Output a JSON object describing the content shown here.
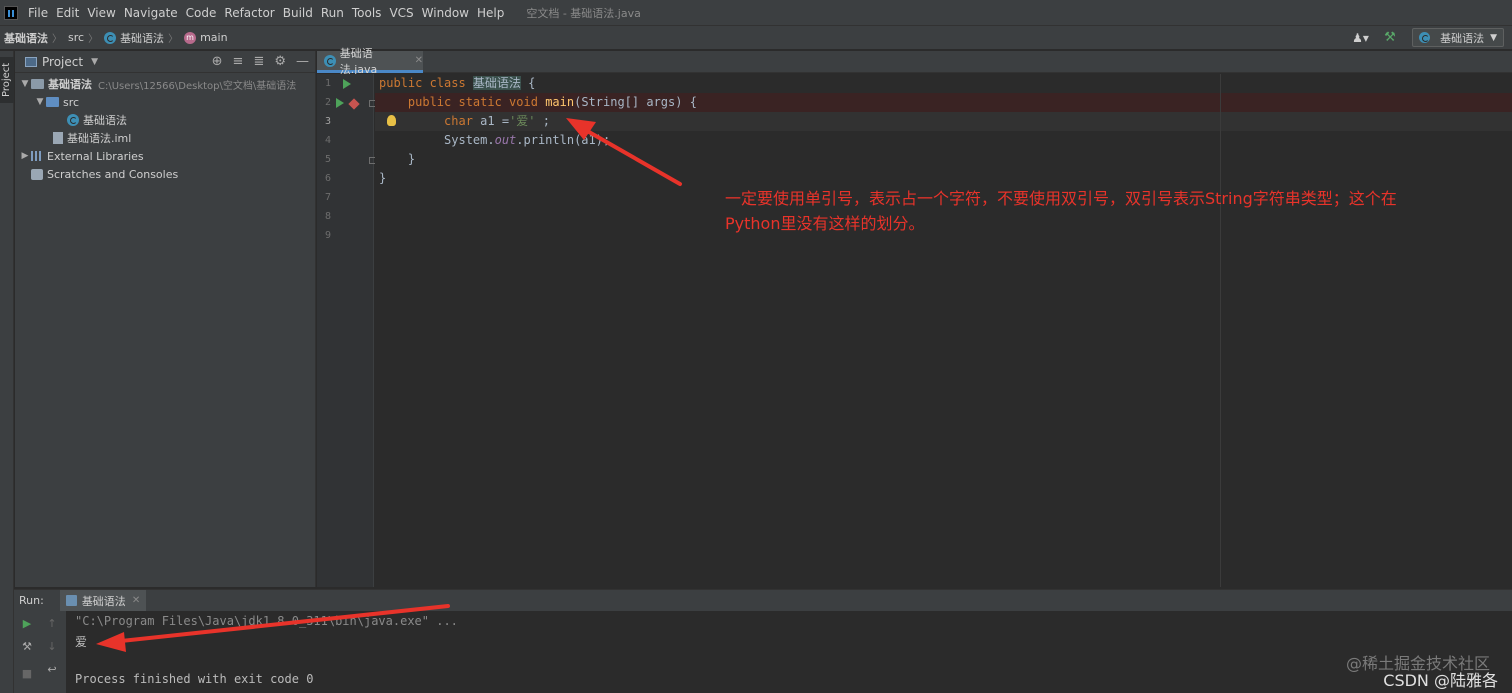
{
  "menubar": {
    "items": [
      "File",
      "Edit",
      "View",
      "Navigate",
      "Code",
      "Refactor",
      "Build",
      "Run",
      "Tools",
      "VCS",
      "Window",
      "Help"
    ],
    "window_title": "空文档 - 基础语法.java"
  },
  "breadcrumb": {
    "project": "基础语法",
    "folder": "src",
    "class": "基础语法",
    "method": "main"
  },
  "nav_right": {
    "run_config": "基础语法"
  },
  "left_strip": {
    "label": "Project"
  },
  "project_panel": {
    "title": "Project",
    "root_name": "基础语法",
    "root_path": "C:\\Users\\12566\\Desktop\\空文档\\基础语法",
    "src": "src",
    "class_file": "基础语法",
    "iml_file": "基础语法.iml",
    "external_libraries": "External Libraries",
    "scratches": "Scratches and Consoles"
  },
  "editor": {
    "tab_label": "基础语法.java",
    "line_numbers": [
      "1",
      "2",
      "3",
      "4",
      "5",
      "6",
      "7",
      "8",
      "9"
    ],
    "code": {
      "l1_kw": "public class ",
      "l1_cls": "基础语法",
      "l1_rest": " {",
      "l2_indent": "    ",
      "l2_kw": "public static void ",
      "l2_fn": "main",
      "l2_rest": "(String[] args) {",
      "l3_indent": "         ",
      "l3_kw": "char",
      "l3_mid": " a1 =",
      "l3_str": "'爱'",
      "l3_rest": " ;",
      "l4_a": "         System.",
      "l4_fld": "out",
      "l4_b": ".println(a1);",
      "l5": "    }",
      "l6": "}"
    }
  },
  "annotation": {
    "line1": "一定要使用单引号，表示占一个字符，不要使用双引号，双引号表示String字符串类型；这个在",
    "line2": "Python里没有这样的划分。"
  },
  "run_panel": {
    "label": "Run:",
    "tab": "基础语法",
    "cmd": "\"C:\\Program Files\\Java\\jdk1.8.0_311\\bin\\java.exe\" ...",
    "output": "爱",
    "finished": "Process finished with exit code 0"
  },
  "watermark": {
    "line1": "@稀土掘金技术社区",
    "line2": "CSDN @陆雅各"
  },
  "colors": {
    "annotation_red": "#e8332a",
    "keyword": "#cc7832",
    "function": "#ffc66d",
    "string": "#6a8759"
  }
}
